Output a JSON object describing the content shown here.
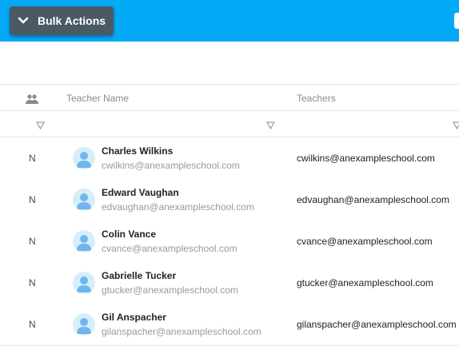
{
  "toolbar": {
    "bulk_actions_label": "Bulk Actions"
  },
  "table": {
    "columns": {
      "icon": "people-icon",
      "teacher_name": "Teacher Name",
      "teachers": "Teachers"
    },
    "rows": [
      {
        "flag": "N",
        "name": "Charles Wilkins",
        "email": "cwilkins@anexampleschool.com",
        "teacher": "cwilkins@anexampleschool.com"
      },
      {
        "flag": "N",
        "name": "Edward Vaughan",
        "email": "edvaughan@anexampleschool.com",
        "teacher": "edvaughan@anexampleschool.com"
      },
      {
        "flag": "N",
        "name": "Colin Vance",
        "email": "cvance@anexampleschool.com",
        "teacher": "cvance@anexampleschool.com"
      },
      {
        "flag": "N",
        "name": "Gabrielle Tucker",
        "email": "gtucker@anexampleschool.com",
        "teacher": "gtucker@anexampleschool.com"
      },
      {
        "flag": "N",
        "name": "Gil Anspacher",
        "email": "gilanspacher@anexampleschool.com",
        "teacher": "gilanspacher@anexampleschool.com"
      }
    ]
  },
  "colors": {
    "topbar": "#03a9f4",
    "button": "#4a5966",
    "avatar_bg": "#d6eefa",
    "avatar_fg": "#6fb6ee"
  }
}
